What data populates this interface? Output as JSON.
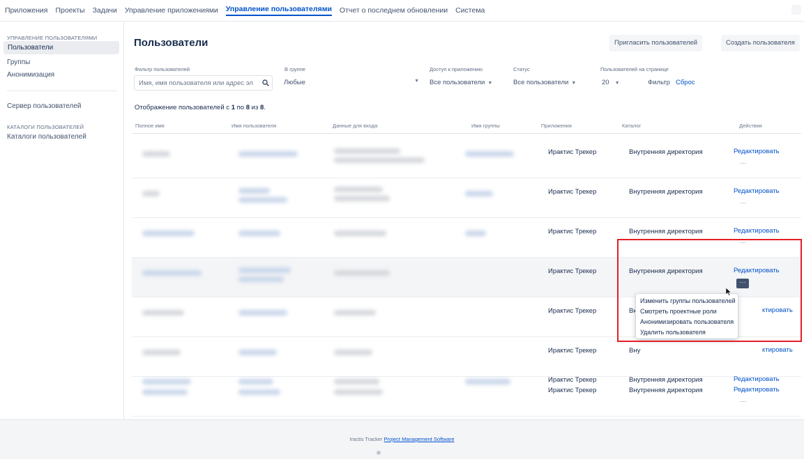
{
  "topnav": {
    "tabs": [
      {
        "label": "Приложения"
      },
      {
        "label": "Проекты"
      },
      {
        "label": "Задачи"
      },
      {
        "label": "Управление приложениями"
      },
      {
        "label": "Управление пользователями"
      },
      {
        "label": "Отчет о последнем обновлении"
      },
      {
        "label": "Система"
      }
    ],
    "active_tab": "Управление пользователями"
  },
  "sidebar": {
    "section1_heading": "УПРАВЛЕНИЕ ПОЛЬЗОВАТЕЛЯМИ",
    "section1_items": [
      {
        "label": "Пользователи"
      },
      {
        "label": "Группы"
      },
      {
        "label": "Анонимизация"
      }
    ],
    "item_server": "Сервер пользователей",
    "section2_heading": "КАТАЛОГИ ПОЛЬЗОВАТЕЛЕЙ",
    "section2_items": [
      {
        "label": "Каталоги пользователей"
      }
    ]
  },
  "main": {
    "title": "Пользователи",
    "invite_button": "Пригласить пользователей",
    "create_button": "Создать пользователя",
    "filters": {
      "user_filter_label": "Фильтр пользователей",
      "user_filter_placeholder": "Имя, имя пользователя или адрес эл",
      "group_label": "В группе",
      "group_value": "Любые",
      "app_access_label": "Доступ к приложению",
      "app_access_value": "Все пользователи",
      "status_label": "Статус",
      "status_value": "Все пользователи",
      "per_page_label": "Пользователей на странице",
      "per_page_value": "20",
      "filter_button": "Фильтр",
      "reset_link": "Сброс"
    },
    "summary": {
      "prefix": "Отображение пользователей с ",
      "from": "1",
      "mid1": " по ",
      "to": "8",
      "mid2": " из ",
      "total": "8",
      "suffix": "."
    },
    "table": {
      "headers": [
        "Полное имя",
        "Имя пользователя",
        "Данные для входа",
        "Имя группы",
        "Приложения",
        "Каталог",
        "Действия"
      ],
      "rows": [
        {
          "app": "Ирактис Трекер",
          "directory": "Внутренняя директория",
          "action": "Редактировать",
          "more": "···"
        },
        {
          "app": "Ирактис Трекер",
          "directory": "Внутренняя директория",
          "action": "Редактировать",
          "more": "···"
        },
        {
          "app": "Ирактис Трекер",
          "directory": "Внутренняя директория",
          "action": "Редактировать",
          "more": "···"
        },
        {
          "app": "Ирактис Трекер",
          "directory": "Внутренняя директория",
          "action": "Редактировать",
          "more": "···"
        },
        {
          "app": "Ирактис Трекер",
          "directory": "Вну",
          "action": "ктировать",
          "more": ""
        },
        {
          "app": "Ирактис Трекер",
          "directory": "Вну",
          "action": "ктировать",
          "more": ""
        },
        {
          "app": "Ирактис Трекер",
          "directory": "Внутренняя директория",
          "action": "Редактировать",
          "more": "···"
        },
        {
          "app": "Ирактис Трекер",
          "directory": "Внутренняя директория",
          "action": "Редактировать",
          "more": "···"
        }
      ]
    },
    "actions_menu": {
      "items": [
        {
          "label": "Изменить группы пользователей"
        },
        {
          "label": "Смотреть проектные роли"
        },
        {
          "label": "Анонимизировать пользователя"
        },
        {
          "label": "Удалить пользователя"
        }
      ]
    }
  },
  "footer": {
    "prefix": "Iractis Tracker ",
    "link": "Project Management Software"
  },
  "colors": {
    "accent": "#0052cc",
    "highlight_border": "#e51e25",
    "row_highlight": "#f4f5f7"
  }
}
